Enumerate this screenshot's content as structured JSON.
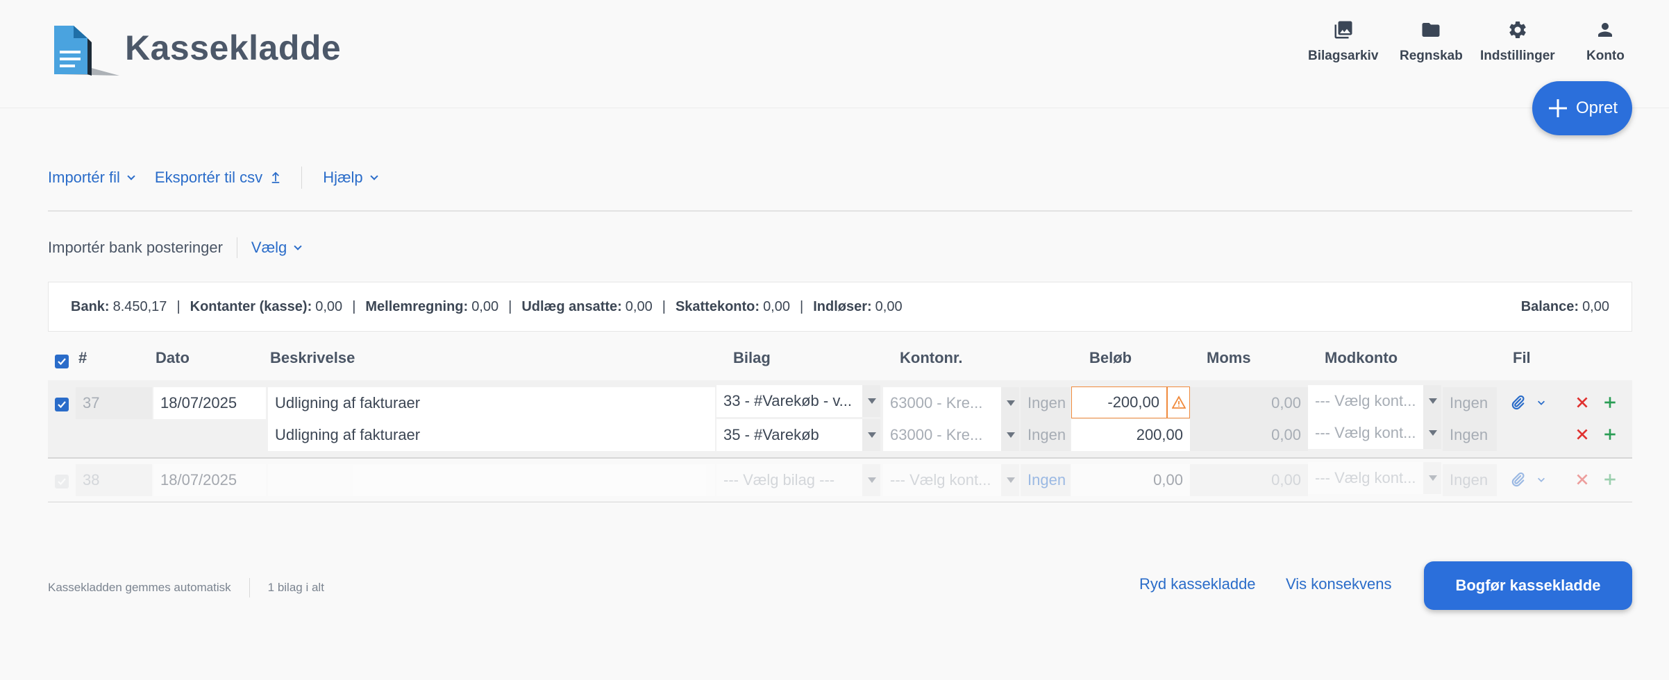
{
  "header": {
    "title": "Kassekladde",
    "nav": [
      {
        "label": "Bilagsarkiv",
        "icon": "photo-archive-icon"
      },
      {
        "label": "Regnskab",
        "icon": "folder-icon"
      },
      {
        "label": "Indstillinger",
        "icon": "gear-icon"
      },
      {
        "label": "Konto",
        "icon": "user-icon"
      }
    ],
    "create_label": "Opret"
  },
  "toolbar": {
    "import_file": "Importér fil",
    "export_csv": "Eksportér til csv",
    "help": "Hjælp"
  },
  "bank_import": {
    "label": "Importér bank posteringer",
    "choose": "Vælg"
  },
  "summary": {
    "bank_label": "Bank:",
    "bank_value": "8.450,17",
    "cash_label": "Kontanter (kasse):",
    "cash_value": "0,00",
    "interim_label": "Mellemregning:",
    "interim_value": "0,00",
    "expense_label": "Udlæg ansatte:",
    "expense_value": "0,00",
    "tax_label": "Skattekonto:",
    "tax_value": "0,00",
    "redeemer_label": "Indløser:",
    "redeemer_value": "0,00",
    "balance_label": "Balance:",
    "balance_value": "0,00"
  },
  "table": {
    "columns": {
      "number": "#",
      "date": "Dato",
      "description": "Beskrivelse",
      "voucher": "Bilag",
      "account": "Kontonr.",
      "amount": "Beløb",
      "vat": "Moms",
      "offset": "Modkonto",
      "file": "Fil"
    },
    "entry": {
      "number": "37",
      "date": "18/07/2025",
      "lines": [
        {
          "description": "Udligning af fakturaer",
          "voucher": "33 - #Varekøb - v...",
          "account": "63000 - Kre...",
          "vat_code": "Ingen",
          "amount": "-200,00",
          "vat": "0,00",
          "offset": "--- Vælg kont...",
          "offset_vat": "Ingen"
        },
        {
          "description": "Udligning af fakturaer",
          "voucher": "35 - #Varekøb",
          "account": "63000 - Kre...",
          "vat_code": "Ingen",
          "amount": "200,00",
          "vat": "0,00",
          "offset": "--- Vælg kont...",
          "offset_vat": "Ingen"
        }
      ]
    },
    "new_entry": {
      "number": "38",
      "date": "18/07/2025",
      "voucher": "--- Vælg bilag ---",
      "account": "--- Vælg kont...",
      "vat_code": "Ingen",
      "amount": "0,00",
      "vat": "0,00",
      "offset": "--- Vælg kont...",
      "offset_vat": "Ingen"
    }
  },
  "footer": {
    "autosave": "Kassekladden gemmes automatisk",
    "count": "1 bilag i alt",
    "clear": "Ryd kassekladde",
    "show_consequence": "Vis konsekvens",
    "post": "Bogfør kassekladde"
  },
  "colors": {
    "accent": "#2b6fdb",
    "warning": "#f08a3c",
    "delete": "#e0312f",
    "add": "#2a9d55"
  }
}
